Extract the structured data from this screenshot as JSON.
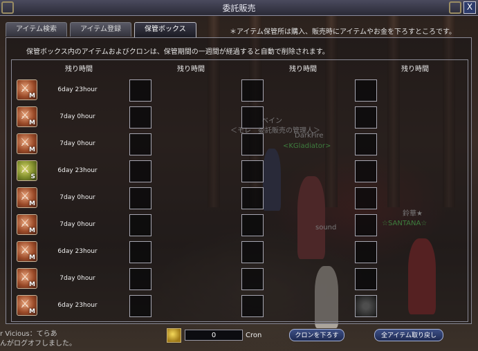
{
  "window": {
    "title": "委託販売",
    "close": "X"
  },
  "tabs": [
    {
      "label": "アイテム検索"
    },
    {
      "label": "アイテム登録"
    },
    {
      "label": "保管ボックス"
    }
  ],
  "tab_note": "＊アイテム保管所は購入、販売時にアイテムやお金を下ろすところです。",
  "notice": "保管ボックス内のアイテムおよびクロンは、保管期間の一週間が経過すると自動で削除されます。",
  "column_header": "残り時間",
  "rows": [
    {
      "icon": "bronze-sword-item-icon",
      "grade": "M",
      "time": "6day 23hour"
    },
    {
      "icon": "bronze-sword-item-icon",
      "grade": "M",
      "time": "7day 0hour"
    },
    {
      "icon": "bronze-sword-item-icon",
      "grade": "M",
      "time": "7day 0hour"
    },
    {
      "icon": "green-wand-item-icon",
      "grade": "S",
      "time": "6day 23hour"
    },
    {
      "icon": "bronze-sword-item-icon",
      "grade": "M",
      "time": "7day 0hour"
    },
    {
      "icon": "bronze-sword-item-icon",
      "grade": "M",
      "time": "7day 0hour"
    },
    {
      "icon": "bronze-sword-item-icon",
      "grade": "M",
      "time": "6day 23hour"
    },
    {
      "icon": "bronze-sword-item-icon",
      "grade": "M",
      "time": "7day 0hour"
    },
    {
      "icon": "bronze-sword-item-icon",
      "grade": "M",
      "time": "6day 23hour"
    }
  ],
  "cron": {
    "value": "0",
    "label": "Cron"
  },
  "buttons": {
    "withdraw": "クロンを下ろす",
    "return_all": "全アイテム取り戻し"
  },
  "scene": {
    "npc_name": "ベイン",
    "npc_title": "＜モレ　委託販売の管理人＞",
    "player1": "DarkFire",
    "player1_guild": "<KGladiator>",
    "player2": "鈴華★",
    "player2_guild": "☆SANTANA☆",
    "sound": "sound",
    "chat1": "r Vicious：てらあ",
    "chat2": "んがログオフしました。"
  }
}
